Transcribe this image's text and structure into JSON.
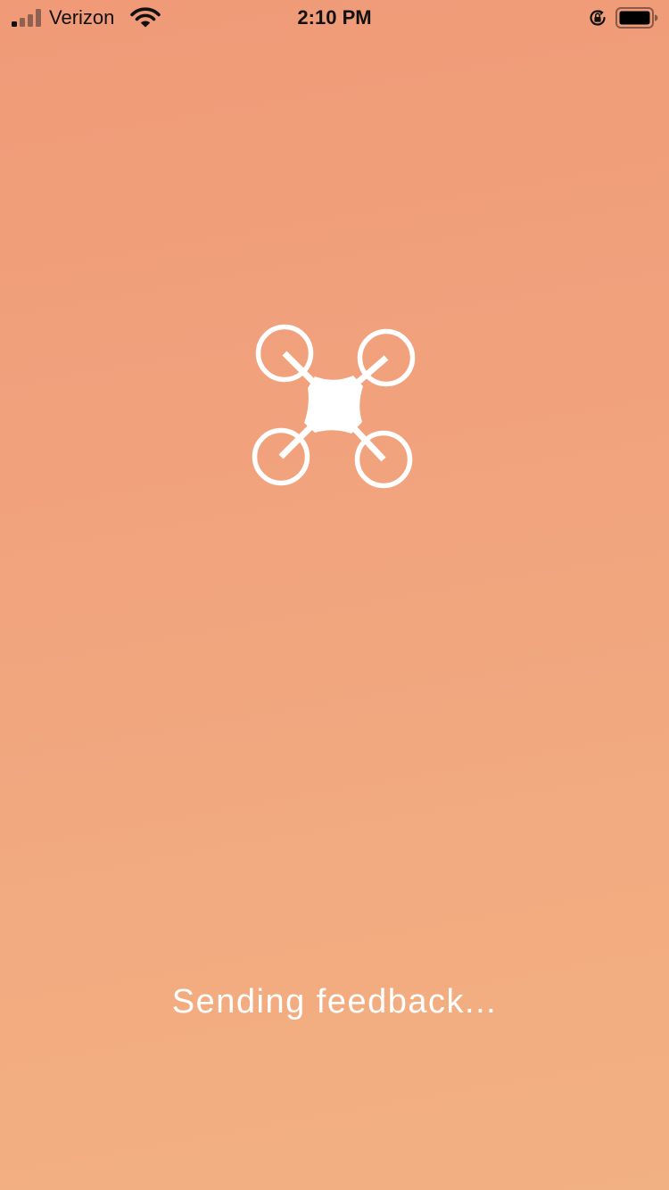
{
  "status_bar": {
    "carrier": "Verizon",
    "time": "2:10 PM",
    "signal_bars_active": 1,
    "signal_bars_total": 4
  },
  "icons": {
    "signal": "cellular-signal-icon",
    "wifi": "wifi-icon",
    "orientation_lock": "orientation-lock-icon",
    "battery": "battery-icon",
    "drone": "drone-icon"
  },
  "loading": {
    "message": "Sending feedback..."
  },
  "colors": {
    "background_top": "#F09A78",
    "background_bottom": "#F2B182",
    "foreground": "#FFFFFF",
    "status_text": "#111111"
  }
}
